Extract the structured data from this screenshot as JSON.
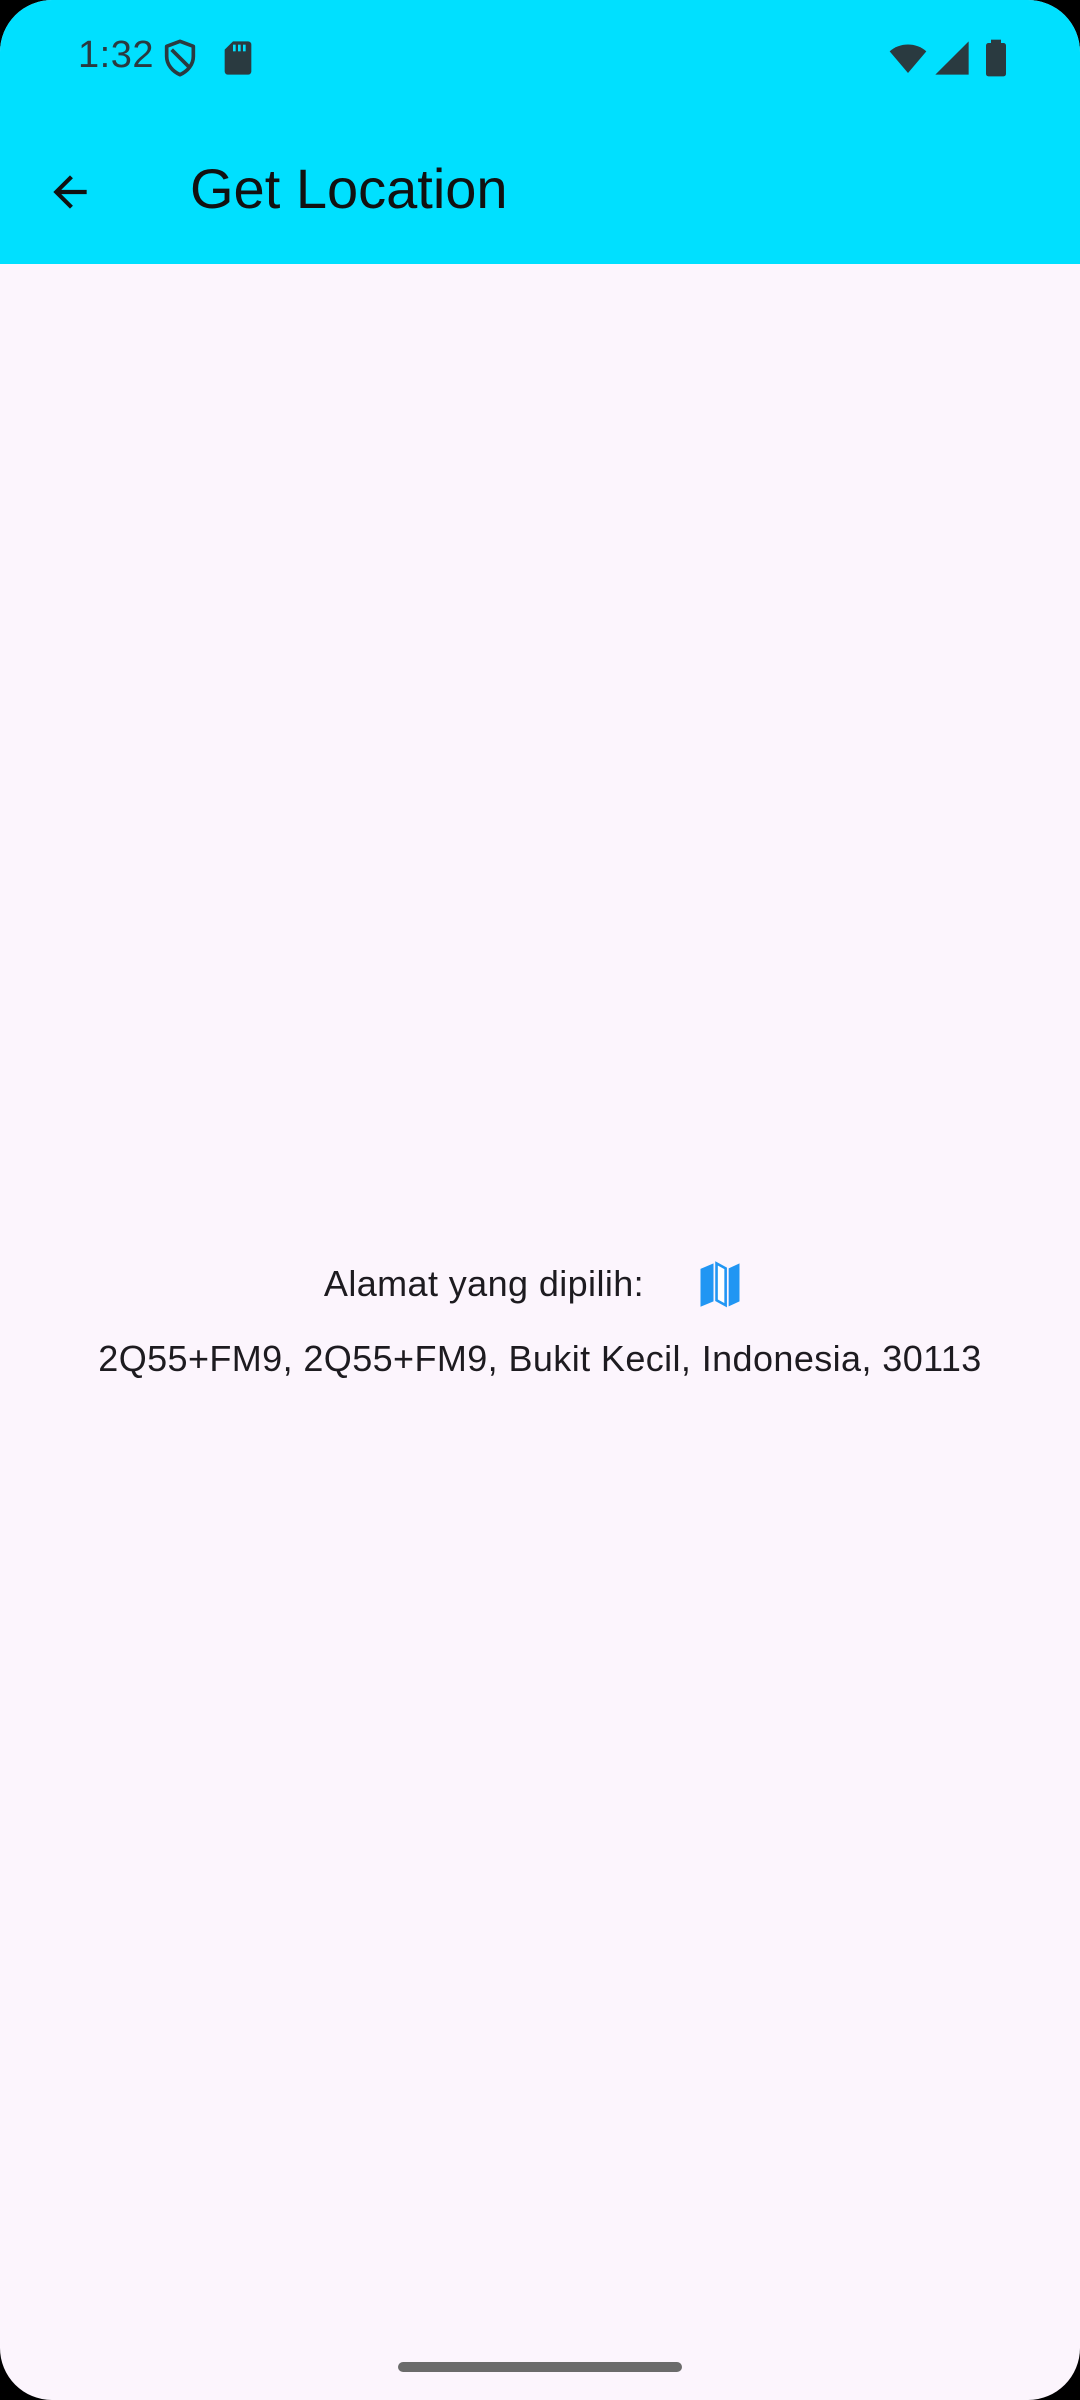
{
  "status_bar": {
    "time": "1:32",
    "icons": [
      "shield-icon",
      "sd-card-icon",
      "wifi-icon",
      "cell-signal-icon",
      "battery-icon"
    ]
  },
  "app_bar": {
    "back_icon": "arrow-back-icon",
    "title": "Get Location",
    "background_color": "#00e0ff"
  },
  "main": {
    "address_label": "Alamat yang dipilih:",
    "map_icon": "map-icon",
    "map_icon_color": "#2196f3",
    "address_value": "2Q55+FM9, 2Q55+FM9, Bukit Kecil, Indonesia, 30113"
  }
}
